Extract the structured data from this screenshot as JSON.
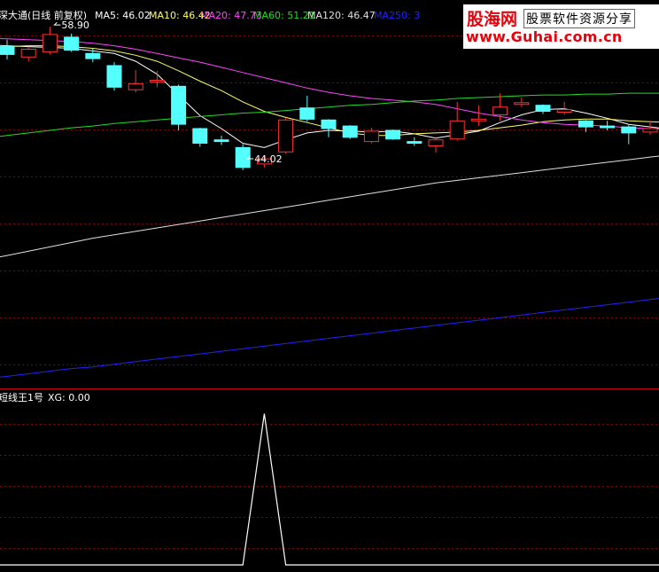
{
  "header": {
    "main_title": "深大通(日线 前复权)",
    "ma_labels": [
      {
        "text": "MA5: 46.02",
        "color": "#ffffff"
      },
      {
        "text": "MA10: 46.42",
        "color": "#ffff66"
      },
      {
        "text": "MA20: 47.73",
        "color": "#ff44ff"
      },
      {
        "text": "MA60: 51.21",
        "color": "#22dd22"
      },
      {
        "text": "MA120: 46.47",
        "color": "#e0e0e0"
      },
      {
        "text": "MA250: 3",
        "color": "#2222ff"
      }
    ],
    "indicator_title": "短线王1号",
    "indicator_value": "XG: 0.00"
  },
  "watermark": {
    "line1_brand": "股海网",
    "line1_tag": "股票软件资源分享",
    "line2": "www.Guhai.com.cn"
  },
  "colors": {
    "up": "#ff3232",
    "down": "#54ffff",
    "grid": "#8a0000",
    "panel_border": "#c00000",
    "ma5": "#ffffff",
    "ma10": "#ffff66",
    "ma20": "#ff44ff",
    "ma60": "#22dd22",
    "ma120": "#e0e0e0",
    "ma250": "#2222ff",
    "xg": "#ffffff"
  },
  "chart_data": [
    {
      "type": "candlestick",
      "price_ylim": [
        17,
        62
      ],
      "annotations": [
        {
          "label": "58.90",
          "index": 2,
          "value": 58.9,
          "kind": "high"
        },
        {
          "label": "44.02",
          "index": 11,
          "value": 44.02,
          "kind": "low"
        }
      ],
      "candles": [
        {
          "o": 56.6,
          "h": 57.4,
          "c": 55.7,
          "l": 55.1
        },
        {
          "o": 55.4,
          "h": 56.6,
          "c": 56.3,
          "l": 54.9
        },
        {
          "o": 56.0,
          "h": 58.9,
          "c": 58.0,
          "l": 55.7
        },
        {
          "o": 57.7,
          "h": 58.1,
          "c": 56.2,
          "l": 56.0
        },
        {
          "o": 55.8,
          "h": 56.4,
          "c": 55.2,
          "l": 54.8
        },
        {
          "o": 54.4,
          "h": 54.8,
          "c": 51.9,
          "l": 51.5
        },
        {
          "o": 51.6,
          "h": 53.9,
          "c": 52.3,
          "l": 51.3
        },
        {
          "o": 52.5,
          "h": 53.8,
          "c": 52.7,
          "l": 51.9
        },
        {
          "o": 52.0,
          "h": 52.2,
          "c": 47.6,
          "l": 46.9
        },
        {
          "o": 47.1,
          "h": 47.2,
          "c": 45.4,
          "l": 45.0
        },
        {
          "o": 45.8,
          "h": 46.3,
          "c": 45.6,
          "l": 45.2
        },
        {
          "o": 44.9,
          "h": 45.3,
          "c": 42.6,
          "l": 42.3
        },
        {
          "o": 43.0,
          "h": 44.0,
          "c": 43.6,
          "l": 42.6
        },
        {
          "o": 44.4,
          "h": 48.3,
          "c": 48.1,
          "l": 44.2
        },
        {
          "o": 49.5,
          "h": 50.9,
          "c": 48.2,
          "l": 47.9
        },
        {
          "o": 48.1,
          "h": 48.2,
          "c": 47.1,
          "l": 46.1
        },
        {
          "o": 47.4,
          "h": 47.5,
          "c": 46.1,
          "l": 45.9
        },
        {
          "o": 45.6,
          "h": 47.2,
          "c": 46.8,
          "l": 45.4
        },
        {
          "o": 46.9,
          "h": 47.0,
          "c": 45.9,
          "l": 45.8
        },
        {
          "o": 45.6,
          "h": 46.1,
          "c": 45.4,
          "l": 45.1
        },
        {
          "o": 45.1,
          "h": 46.1,
          "c": 45.8,
          "l": 44.3
        },
        {
          "o": 45.9,
          "h": 50.2,
          "c": 48.0,
          "l": 45.7
        },
        {
          "o": 48.0,
          "h": 49.8,
          "c": 48.2,
          "l": 47.4
        },
        {
          "o": 48.7,
          "h": 51.2,
          "c": 49.6,
          "l": 48.0
        },
        {
          "o": 49.9,
          "h": 50.7,
          "c": 50.1,
          "l": 49.6
        },
        {
          "o": 49.8,
          "h": 49.9,
          "c": 49.1,
          "l": 48.8
        },
        {
          "o": 49.0,
          "h": 50.2,
          "c": 49.3,
          "l": 48.7
        },
        {
          "o": 48.0,
          "h": 48.1,
          "c": 47.3,
          "l": 46.7
        },
        {
          "o": 47.4,
          "h": 48.0,
          "c": 47.2,
          "l": 46.9
        },
        {
          "o": 47.3,
          "h": 47.5,
          "c": 46.6,
          "l": 45.3
        },
        {
          "o": 46.7,
          "h": 48.0,
          "c": 47.1,
          "l": 46.4
        }
      ],
      "series": [
        {
          "name": "MA5",
          "values": [
            56.7,
            56.6,
            56.5,
            56.4,
            56.1,
            55.8,
            54.9,
            53.4,
            51.0,
            48.6,
            47.1,
            45.4,
            44.9,
            45.8,
            46.6,
            46.9,
            46.8,
            46.7,
            46.8,
            46.5,
            46.0,
            46.4,
            46.8,
            47.8,
            48.7,
            49.3,
            49.4,
            48.9,
            48.3,
            47.6,
            47.3
          ]
        },
        {
          "name": "MA10",
          "values": [
            56.6,
            56.7,
            56.7,
            56.6,
            56.4,
            56.1,
            55.6,
            54.9,
            53.8,
            52.6,
            51.5,
            50.2,
            49.1,
            48.4,
            47.8,
            47.2,
            46.6,
            46.3,
            46.3,
            46.5,
            46.6,
            46.7,
            46.9,
            47.2,
            47.5,
            47.9,
            48.1,
            48.2,
            48.2,
            48.0,
            47.9
          ]
        },
        {
          "name": "MA20",
          "values": [
            57.5,
            57.4,
            57.3,
            57.2,
            57.0,
            56.7,
            56.3,
            55.8,
            55.3,
            54.8,
            54.2,
            53.6,
            53.0,
            52.4,
            51.8,
            51.3,
            50.9,
            50.6,
            50.4,
            50.2,
            49.9,
            49.4,
            48.9,
            48.5,
            48.1,
            47.8,
            47.6,
            47.5,
            47.4,
            47.2,
            47.1
          ]
        },
        {
          "name": "MA60",
          "values": [
            46.3,
            46.6,
            46.9,
            47.2,
            47.4,
            47.7,
            47.9,
            48.1,
            48.3,
            48.5,
            48.7,
            48.9,
            49.0,
            49.2,
            49.4,
            49.6,
            49.8,
            49.9,
            50.1,
            50.3,
            50.4,
            50.6,
            50.7,
            50.8,
            50.9,
            51.0,
            51.0,
            51.1,
            51.1,
            51.2,
            51.2
          ]
        },
        {
          "name": "MA120",
          "values": [
            32.4,
            32.9,
            33.4,
            33.9,
            34.4,
            34.8,
            35.2,
            35.6,
            36.0,
            36.4,
            36.8,
            37.2,
            37.6,
            38.0,
            38.4,
            38.8,
            39.2,
            39.6,
            40.0,
            40.4,
            40.8,
            41.1,
            41.4,
            41.7,
            42.0,
            42.3,
            42.6,
            42.9,
            43.2,
            43.5,
            43.8
          ]
        },
        {
          "name": "MA250",
          "values": [
            18.4,
            18.7,
            19.0,
            19.3,
            19.5,
            19.8,
            20.1,
            20.4,
            20.7,
            21.0,
            21.3,
            21.6,
            21.9,
            22.2,
            22.5,
            22.8,
            23.1,
            23.4,
            23.7,
            24.0,
            24.3,
            24.6,
            24.9,
            25.2,
            25.5,
            25.8,
            26.1,
            26.4,
            26.7,
            27.0,
            27.3
          ]
        }
      ]
    },
    {
      "type": "line",
      "title": "短线王1号",
      "series": [
        {
          "name": "XG",
          "values": [
            0,
            0,
            0,
            0,
            0,
            0,
            0,
            0,
            0,
            0,
            0,
            0,
            1,
            0,
            0,
            0,
            0,
            0,
            0,
            0,
            0,
            0,
            0,
            0,
            0,
            0,
            0,
            0,
            0,
            0,
            0
          ]
        }
      ],
      "ylim": [
        0,
        1.05
      ]
    }
  ]
}
